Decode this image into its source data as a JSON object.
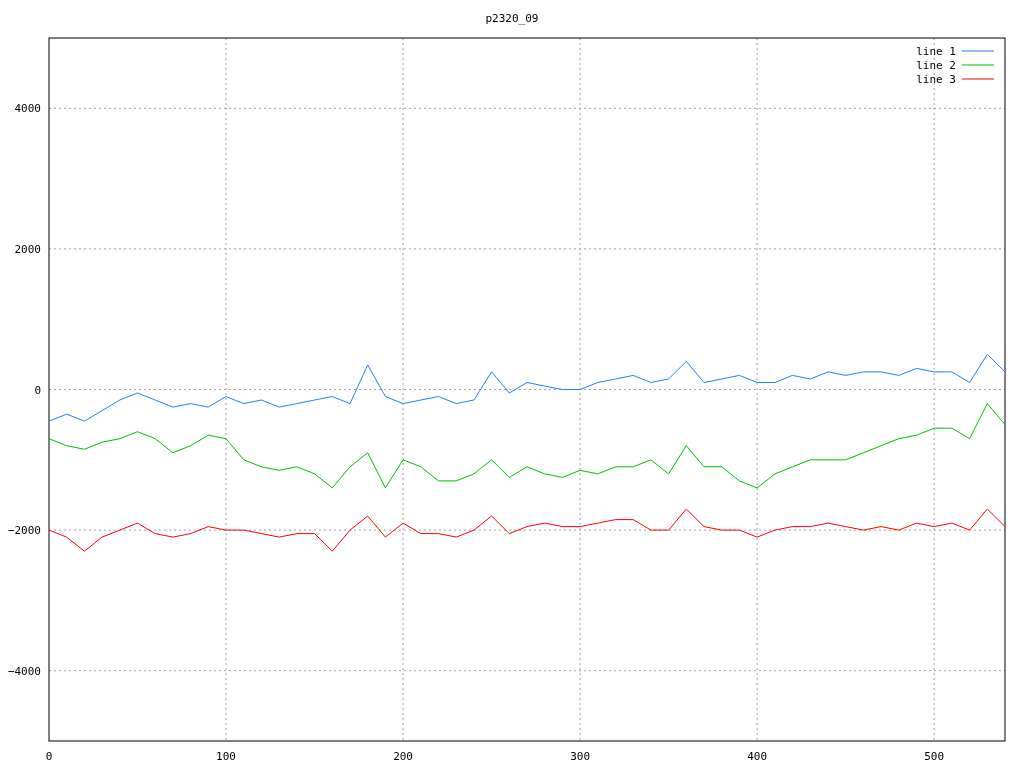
{
  "chart": {
    "chart_data": {
      "type": "line",
      "title": "p2320_09",
      "x": [
        0,
        10,
        20,
        30,
        40,
        50,
        60,
        70,
        80,
        90,
        100,
        110,
        120,
        130,
        140,
        150,
        160,
        170,
        180,
        190,
        200,
        210,
        220,
        230,
        240,
        250,
        260,
        270,
        280,
        290,
        300,
        310,
        320,
        330,
        340,
        350,
        360,
        370,
        380,
        390,
        400,
        410,
        420,
        430,
        440,
        450,
        460,
        470,
        480,
        490,
        500,
        510,
        520,
        530,
        540
      ],
      "series": [
        {
          "name": "line 1",
          "color": "#1f7fff",
          "values": [
            -450,
            -350,
            -450,
            -300,
            -150,
            -50,
            -150,
            -250,
            -200,
            -250,
            -100,
            -200,
            -150,
            -250,
            -200,
            -150,
            -100,
            -200,
            350,
            -100,
            -200,
            -150,
            -100,
            -200,
            -150,
            250,
            -50,
            100,
            50,
            0,
            0,
            100,
            150,
            200,
            100,
            150,
            400,
            100,
            150,
            200,
            100,
            100,
            200,
            150,
            250,
            200,
            250,
            250,
            200,
            300,
            250,
            250,
            100,
            500,
            250
          ]
        },
        {
          "name": "line 2",
          "color": "#00c000",
          "values": [
            -700,
            -800,
            -850,
            -750,
            -700,
            -600,
            -700,
            -900,
            -800,
            -650,
            -700,
            -1000,
            -1100,
            -1150,
            -1100,
            -1200,
            -1400,
            -1100,
            -900,
            -1400,
            -1000,
            -1100,
            -1300,
            -1300,
            -1200,
            -1000,
            -1250,
            -1100,
            -1200,
            -1250,
            -1150,
            -1200,
            -1100,
            -1100,
            -1000,
            -1200,
            -800,
            -1100,
            -1100,
            -1300,
            -1400,
            -1200,
            -1100,
            -1000,
            -1000,
            -1000,
            -900,
            -800,
            -700,
            -650,
            -550,
            -550,
            -700,
            -200,
            -500
          ]
        },
        {
          "name": "line 3",
          "color": "#ff0000",
          "values": [
            -2000,
            -2100,
            -2300,
            -2100,
            -2000,
            -1900,
            -2050,
            -2100,
            -2050,
            -1950,
            -2000,
            -2000,
            -2050,
            -2100,
            -2050,
            -2050,
            -2300,
            -2000,
            -1800,
            -2100,
            -1900,
            -2050,
            -2050,
            -2100,
            -2000,
            -1800,
            -2050,
            -1950,
            -1900,
            -1950,
            -1950,
            -1900,
            -1850,
            -1850,
            -2000,
            -2000,
            -1700,
            -1950,
            -2000,
            -2000,
            -2100,
            -2000,
            -1950,
            -1950,
            -1900,
            -1950,
            -2000,
            -1950,
            -2000,
            -1900,
            -1950,
            -1900,
            -2000,
            -1700,
            -1950
          ]
        }
      ],
      "xlim": [
        0,
        540
      ],
      "ylim": [
        -5000,
        5000
      ],
      "xticks": [
        0,
        100,
        200,
        300,
        400,
        500
      ],
      "yticks": [
        -4000,
        -2000,
        0,
        2000,
        4000
      ],
      "grid": true,
      "legend": true
    }
  }
}
